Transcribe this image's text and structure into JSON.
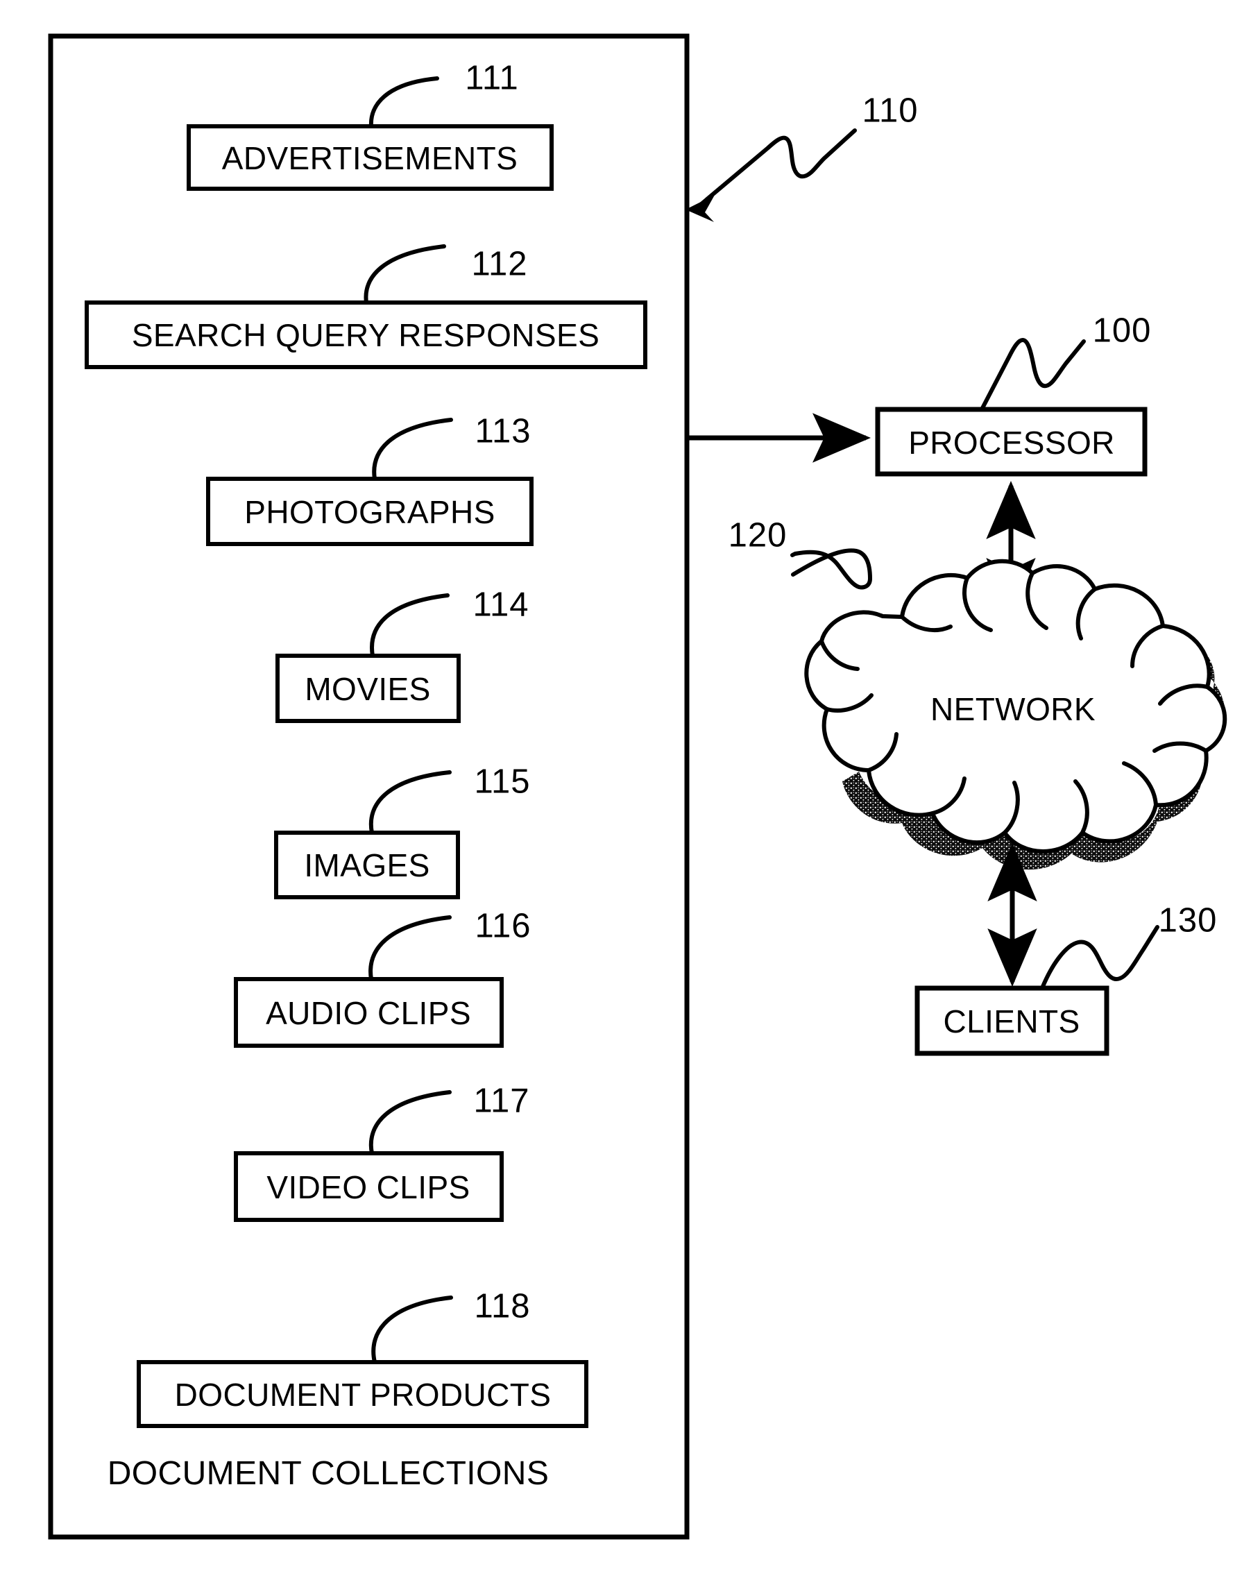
{
  "figure": {
    "type": "patent-block-diagram",
    "background_color": "#ffffff",
    "line_color": "#000000",
    "container": {
      "name": "document-collections-container",
      "caption": "DOCUMENT COLLECTIONS",
      "reference_numeral": "110"
    },
    "boxes": [
      {
        "id": "advertisements",
        "label": "ADVERTISEMENTS",
        "reference_numeral": "111"
      },
      {
        "id": "search-query-responses",
        "label": "SEARCH QUERY RESPONSES",
        "reference_numeral": "112"
      },
      {
        "id": "photographs",
        "label": "PHOTOGRAPHS",
        "reference_numeral": "113"
      },
      {
        "id": "movies",
        "label": "MOVIES",
        "reference_numeral": "114"
      },
      {
        "id": "images",
        "label": "IMAGES",
        "reference_numeral": "115"
      },
      {
        "id": "audio-clips",
        "label": "AUDIO CLIPS",
        "reference_numeral": "116"
      },
      {
        "id": "video-clips",
        "label": "VIDEO CLIPS",
        "reference_numeral": "117"
      },
      {
        "id": "document-products",
        "label": "DOCUMENT PRODUCTS",
        "reference_numeral": "118"
      }
    ],
    "nodes": [
      {
        "id": "processor",
        "label": "PROCESSOR",
        "reference_numeral": "100",
        "shape": "rectangle"
      },
      {
        "id": "network",
        "label": "NETWORK",
        "reference_numeral": "120",
        "shape": "cloud"
      },
      {
        "id": "clients",
        "label": "CLIENTS",
        "reference_numeral": "130",
        "shape": "rectangle"
      }
    ],
    "connections": [
      {
        "from": "document-collections-container",
        "to": "processor",
        "arrow": "single"
      },
      {
        "from": "processor",
        "to": "network",
        "arrow": "double"
      },
      {
        "from": "network",
        "to": "clients",
        "arrow": "double"
      }
    ]
  }
}
